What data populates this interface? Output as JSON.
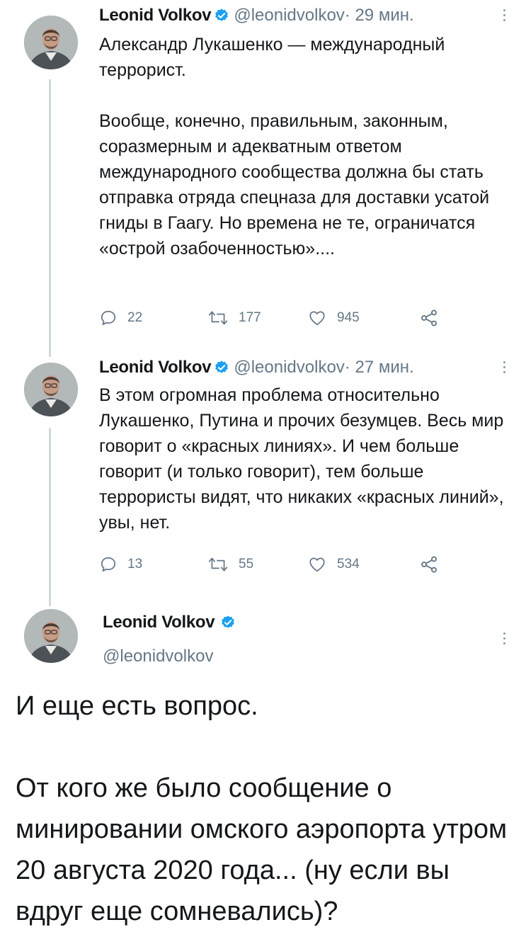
{
  "tweets": [
    {
      "author_name": "Leonid Volkov",
      "handle": "@leonidvolkov",
      "time": " · 29 мин.",
      "text": "Александр Лукашенко — международный террорист.\n\nВообще, конечно, правильным, законным, соразмерным и адекватным ответом международного сообщества должна бы стать отправка отряда спецназа для доставки усатой гниды в Гаагу. Но времена не те, ограничатся «острой озабоченностью»....",
      "replies": "22",
      "retweets": "177",
      "likes": "945"
    },
    {
      "author_name": "Leonid Volkov",
      "handle": "@leonidvolkov",
      "time": " · 27 мин.",
      "text": "В этом огромная проблема относительно Лукашенко, Путина и прочих безумцев. Весь мир говорит о «красных линиях». И чем больше говорит (и только говорит), тем больше террористы видят, что никаких «красных линий», увы, нет.",
      "replies": "13",
      "retweets": "55",
      "likes": "534"
    }
  ],
  "main_tweet": {
    "author_name": "Leonid Volkov",
    "handle": "@leonidvolkov",
    "text": "И еще есть вопрос.\n\nОт кого же было сообщение о минировании омского аэропорта утром 20 августа 2020 года... (ну если вы вдруг еще сомневались)?"
  },
  "icons": {
    "reply": "reply-icon",
    "retweet": "retweet-icon",
    "like": "heart-icon",
    "share": "share-icon",
    "verified": "verified-badge-icon",
    "more": "more-vertical-icon"
  },
  "colors": {
    "text": "#14171a",
    "secondary": "#657786",
    "verified": "#1da1f2",
    "thread_line": "#cfd9de"
  }
}
